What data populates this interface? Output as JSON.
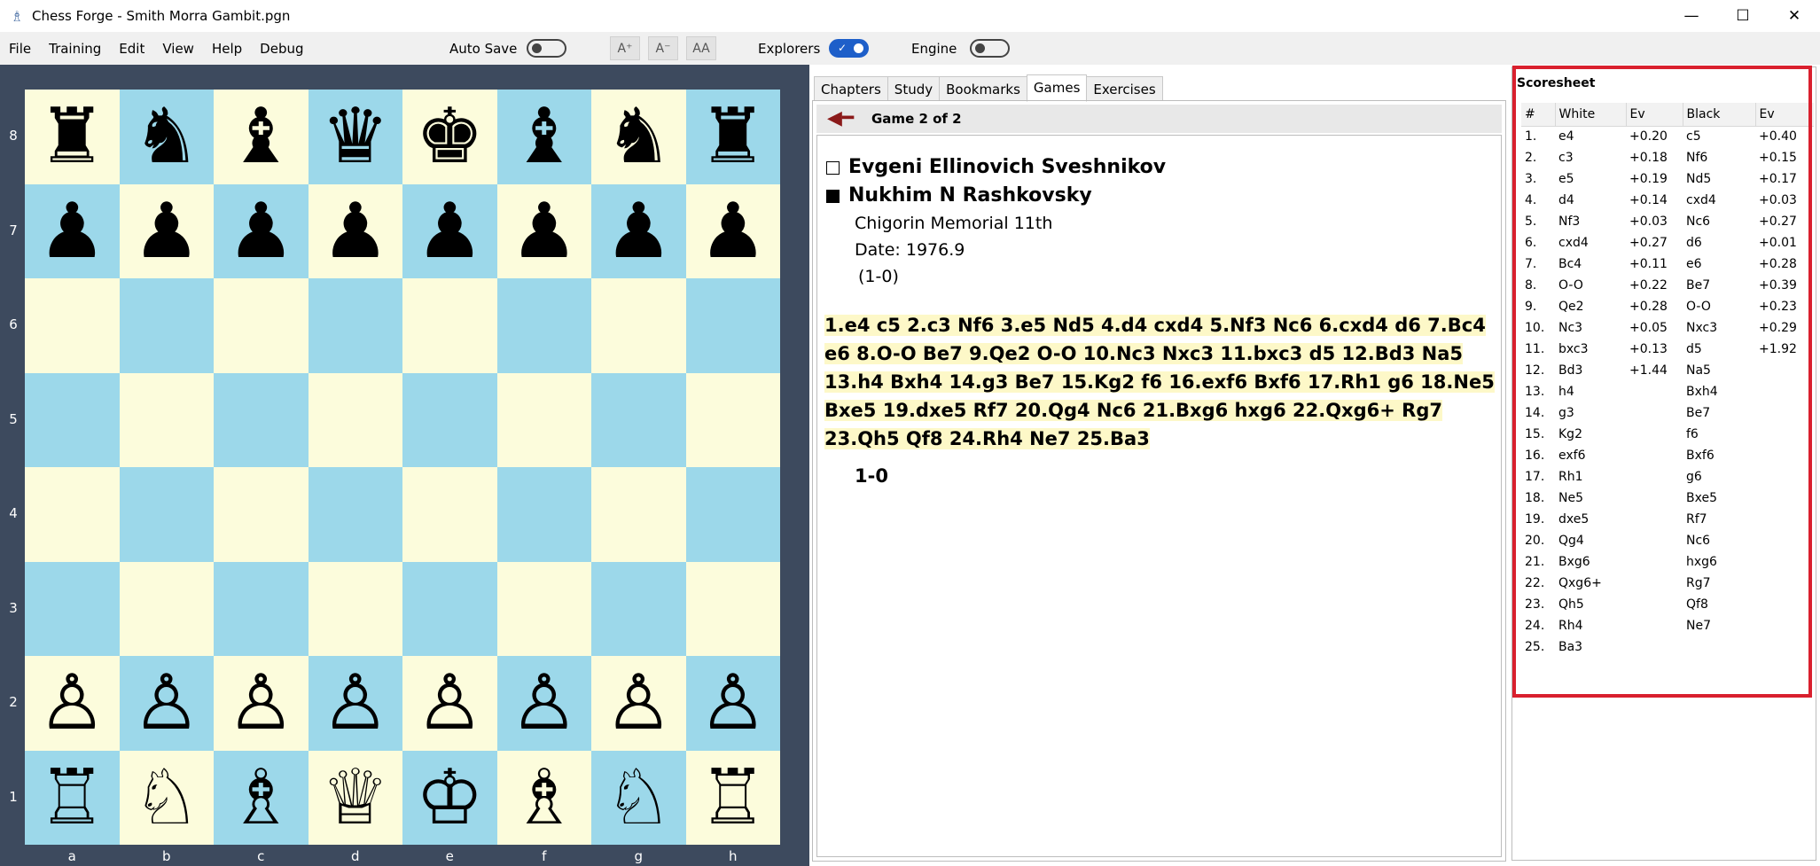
{
  "window": {
    "title": "Chess Forge - Smith Morra Gambit.pgn",
    "minimize": "—",
    "maximize": "☐",
    "close": "✕",
    "app_icon": "♗"
  },
  "menu": {
    "items": [
      "File",
      "Training",
      "Edit",
      "View",
      "Help",
      "Debug"
    ]
  },
  "toolbar": {
    "autosave_label": "Auto Save",
    "autosave_on": false,
    "font_increase": "A⁺",
    "font_decrease": "A⁻",
    "font_reset": "AA",
    "explorers_label": "Explorers",
    "explorers_on": true,
    "engine_label": "Engine",
    "engine_on": false
  },
  "board": {
    "ranks": [
      "8",
      "7",
      "6",
      "5",
      "4",
      "3",
      "2",
      "1"
    ],
    "files": [
      "a",
      "b",
      "c",
      "d",
      "e",
      "f",
      "g",
      "h"
    ],
    "position": [
      [
        "♜",
        "♞",
        "♝",
        "♛",
        "♚",
        "♝",
        "♞",
        "♜"
      ],
      [
        "♟",
        "♟",
        "♟",
        "♟",
        "♟",
        "♟",
        "♟",
        "♟"
      ],
      [
        "",
        "",
        "",
        "",
        "",
        "",
        "",
        ""
      ],
      [
        "",
        "",
        "",
        "",
        "",
        "",
        "",
        ""
      ],
      [
        "",
        "",
        "",
        "",
        "",
        "",
        "",
        ""
      ],
      [
        "",
        "",
        "",
        "",
        "",
        "",
        "",
        ""
      ],
      [
        "♙",
        "♙",
        "♙",
        "♙",
        "♙",
        "♙",
        "♙",
        "♙"
      ],
      [
        "♖",
        "♘",
        "♗",
        "♕",
        "♔",
        "♗",
        "♘",
        "♖"
      ]
    ],
    "light_color": "#fcfcdc",
    "dark_color": "#9cd8ea"
  },
  "tabs": [
    "Chapters",
    "Study",
    "Bookmarks",
    "Games",
    "Exercises"
  ],
  "active_tab": "Games",
  "game": {
    "count_label": "Game 2 of 2",
    "white": "Evgeni Ellinovich Sveshnikov",
    "black": "Nukhim N Rashkovsky",
    "event": "Chigorin Memorial 11th",
    "date": "Date: 1976.9",
    "result_header": "(1-0)",
    "moves_text": "1.e4 c5 2.c3 Nf6 3.e5 Nd5 4.d4 cxd4 5.Nf3 Nc6 6.cxd4 d6 7.Bc4 e6 8.O-O Be7 9.Qe2 O-O 10.Nc3 Nxc3 11.bxc3 d5 12.Bd3 Na5 13.h4 Bxh4 14.g3 Be7 15.Kg2 f6 16.exf6 Bxf6 17.Rh1 g6 18.Ne5 Bxe5 19.dxe5 Rf7 20.Qg4 Nc6 21.Bxg6 hxg6 22.Qxg6+ Rg7 23.Qh5 Qf8 24.Rh4 Ne7 25.Ba3",
    "result": "1-0"
  },
  "scoresheet": {
    "title": "Scoresheet",
    "headers": [
      "#",
      "White",
      "Ev",
      "Black",
      "Ev"
    ],
    "rows": [
      [
        "1.",
        "e4",
        "+0.20",
        "c5",
        "+0.40"
      ],
      [
        "2.",
        "c3",
        "+0.18",
        "Nf6",
        "+0.15"
      ],
      [
        "3.",
        "e5",
        "+0.19",
        "Nd5",
        "+0.17"
      ],
      [
        "4.",
        "d4",
        "+0.14",
        "cxd4",
        "+0.03"
      ],
      [
        "5.",
        "Nf3",
        "+0.03",
        "Nc6",
        "+0.27"
      ],
      [
        "6.",
        "cxd4",
        "+0.27",
        "d6",
        "+0.01"
      ],
      [
        "7.",
        "Bc4",
        "+0.11",
        "e6",
        "+0.28"
      ],
      [
        "8.",
        "O-O",
        "+0.22",
        "Be7",
        "+0.39"
      ],
      [
        "9.",
        "Qe2",
        "+0.28",
        "O-O",
        "+0.23"
      ],
      [
        "10.",
        "Nc3",
        "+0.05",
        "Nxc3",
        "+0.29"
      ],
      [
        "11.",
        "bxc3",
        "+0.13",
        "d5",
        "+1.92"
      ],
      [
        "12.",
        "Bd3",
        "+1.44",
        "Na5",
        ""
      ],
      [
        "13.",
        "h4",
        "",
        "Bxh4",
        ""
      ],
      [
        "14.",
        "g3",
        "",
        "Be7",
        ""
      ],
      [
        "15.",
        "Kg2",
        "",
        "f6",
        ""
      ],
      [
        "16.",
        "exf6",
        "",
        "Bxf6",
        ""
      ],
      [
        "17.",
        "Rh1",
        "",
        "g6",
        ""
      ],
      [
        "18.",
        "Ne5",
        "",
        "Bxe5",
        ""
      ],
      [
        "19.",
        "dxe5",
        "",
        "Rf7",
        ""
      ],
      [
        "20.",
        "Qg4",
        "",
        "Nc6",
        ""
      ],
      [
        "21.",
        "Bxg6",
        "",
        "hxg6",
        ""
      ],
      [
        "22.",
        "Qxg6+",
        "",
        "Rg7",
        ""
      ],
      [
        "23.",
        "Qh5",
        "",
        "Qf8",
        ""
      ],
      [
        "24.",
        "Rh4",
        "",
        "Ne7",
        ""
      ],
      [
        "25.",
        "Ba3",
        "",
        "",
        ""
      ]
    ]
  }
}
